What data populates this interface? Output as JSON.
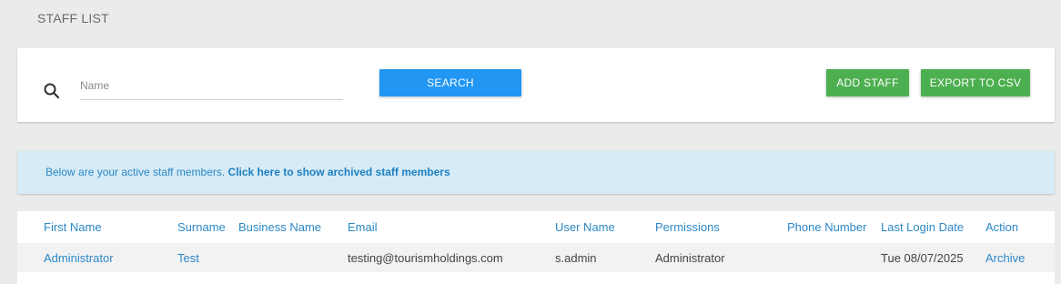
{
  "page": {
    "title": "STAFF LIST"
  },
  "search": {
    "placeholder": "Name",
    "value": "",
    "search_label": "SEARCH",
    "add_label": "ADD STAFF",
    "export_label": "EXPORT TO CSV",
    "icon": "search-icon"
  },
  "banner": {
    "text": "Below are your active staff members. ",
    "link_text": "Click here to show archived staff members"
  },
  "table": {
    "columns": [
      "First Name",
      "Surname",
      "Business Name",
      "Email",
      "User Name",
      "Permissions",
      "Phone Number",
      "Last Login Date",
      "Action"
    ],
    "rows": [
      {
        "first_name": "Administrator",
        "surname": "Test",
        "business_name": "",
        "email": "testing@tourismholdings.com",
        "user_name": "s.admin",
        "permissions": "Administrator",
        "phone_number": "",
        "last_login": "Tue 08/07/2025",
        "action": "Archive"
      }
    ]
  },
  "colors": {
    "primary": "#2196f3",
    "success": "#4caf50",
    "link": "#2b88c6",
    "banner_bg": "#d6ebf5",
    "page_bg": "#ebebeb"
  }
}
